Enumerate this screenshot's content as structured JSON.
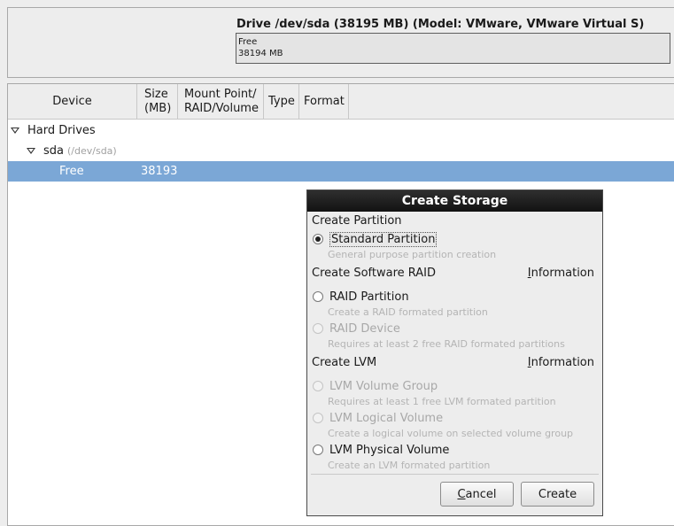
{
  "drive": {
    "title": "Drive /dev/sda (38195 MB) (Model: VMware, VMware Virtual S)",
    "bar": {
      "label": "Free",
      "size": "38194 MB"
    }
  },
  "columns": {
    "device": "Device",
    "size_line1": "Size",
    "size_line2": "(MB)",
    "mount_line1": "Mount Point/",
    "mount_line2": "RAID/Volume",
    "type": "Type",
    "format": "Format"
  },
  "tree": {
    "hard_drives": "Hard Drives",
    "sda": {
      "name": "sda",
      "path": "(/dev/sda)"
    },
    "free": {
      "name": "Free",
      "size": "38193"
    }
  },
  "dialog": {
    "title": "Create Storage",
    "partition_section": "Create Partition",
    "standard_partition": {
      "label": "Standard Partition",
      "desc": "General purpose partition creation"
    },
    "raid_section": "Create Software RAID",
    "raid_info": "Information",
    "raid_partition": {
      "label": "RAID Partition",
      "desc": "Create a RAID formated partition"
    },
    "raid_device": {
      "label": "RAID Device",
      "desc": "Requires at least 2 free RAID formated partitions"
    },
    "lvm_section": "Create LVM",
    "lvm_info": "Information",
    "lvm_volume_group": {
      "label": "LVM Volume Group",
      "desc": "Requires at least 1 free LVM formated partition"
    },
    "lvm_logical_volume": {
      "label": "LVM Logical Volume",
      "desc": "Create a logical volume on selected volume group"
    },
    "lvm_physical_volume": {
      "label": "LVM Physical Volume",
      "desc": "Create an LVM formated partition"
    },
    "cancel": "Cancel",
    "create": "Create"
  },
  "colors": {
    "selection": "#7ba7d6",
    "titlebar": "#1e1e1e"
  }
}
